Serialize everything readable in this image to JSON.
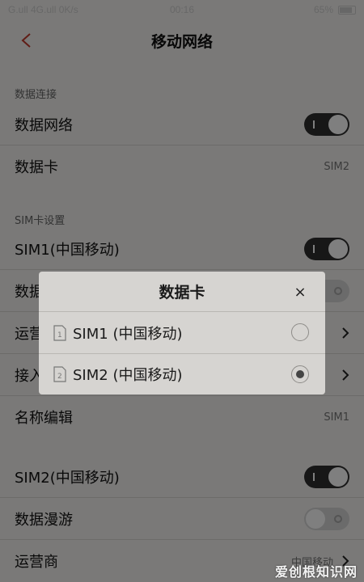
{
  "status_bar": {
    "left": "G.ull 4G.ull 0K/s",
    "time": "00:16",
    "battery": "65%"
  },
  "header": {
    "title": "移动网络"
  },
  "sections": {
    "data_connection": "数据连接",
    "sim_settings": "SIM卡设置"
  },
  "rows": {
    "data_network": {
      "label": "数据网络",
      "toggle": "on"
    },
    "data_card": {
      "label": "数据卡",
      "value": "SIM2"
    },
    "sim1": {
      "label": "SIM1(中国移动)",
      "toggle": "on"
    },
    "sim1_roaming": {
      "label": "数据漫游",
      "toggle": "off"
    },
    "sim1_operator": {
      "label": "运营商"
    },
    "sim1_apn": {
      "label": "接入点"
    },
    "name_edit": {
      "label": "名称编辑",
      "value": "SIM1"
    },
    "sim2": {
      "label": "SIM2(中国移动)",
      "toggle": "on"
    },
    "sim2_roaming": {
      "label": "数据漫游",
      "toggle": "off"
    },
    "sim2_operator": {
      "label": "运营商",
      "value": "中国移动"
    }
  },
  "dialog": {
    "title": "数据卡",
    "close_glyph": "×",
    "options": [
      {
        "label": "SIM1 (中国移动)",
        "icon_number": "1",
        "selected": false
      },
      {
        "label": "SIM2 (中国移动)",
        "icon_number": "2",
        "selected": true
      }
    ]
  },
  "watermark": "爱创根知识网",
  "colors": {
    "accent_back": "#c0392b",
    "toggle_on": "#2f2f2f",
    "dialog_bg": "#d6d4d1"
  }
}
